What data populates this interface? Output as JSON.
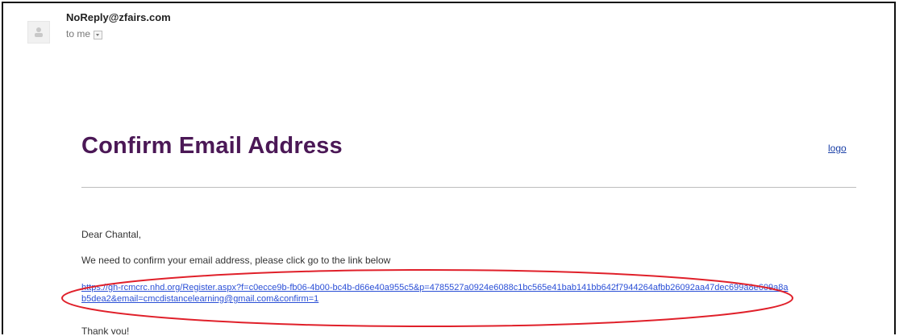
{
  "email": {
    "sender": "NoReply@zfairs.com",
    "recipient_label": "to me",
    "title": "Confirm Email Address",
    "logo_text": "logo",
    "greeting": "Dear Chantal,",
    "instruction": "We need to confirm your email address, please click go to the link below",
    "confirm_link": "https://gh-rcmcrc.nhd.org/Register.aspx?f=c0ecce9b-fb06-4b00-bc4b-d66e40a955c5&p=4785527a0924e6088c1bc565e41bab141bb642f7944264afbb26092aa47dec699a8e609a8ab5dea2&email=cmcdistancelearning@gmail.com&confirm=1",
    "closing": "Thank you!"
  },
  "colors": {
    "title": "#4b1856",
    "link": "#2a4fd6",
    "highlight_ellipse": "#e0202a"
  },
  "icons": {
    "avatar": "default-user-icon",
    "recipient_dropdown": "dropdown-arrow-icon"
  }
}
